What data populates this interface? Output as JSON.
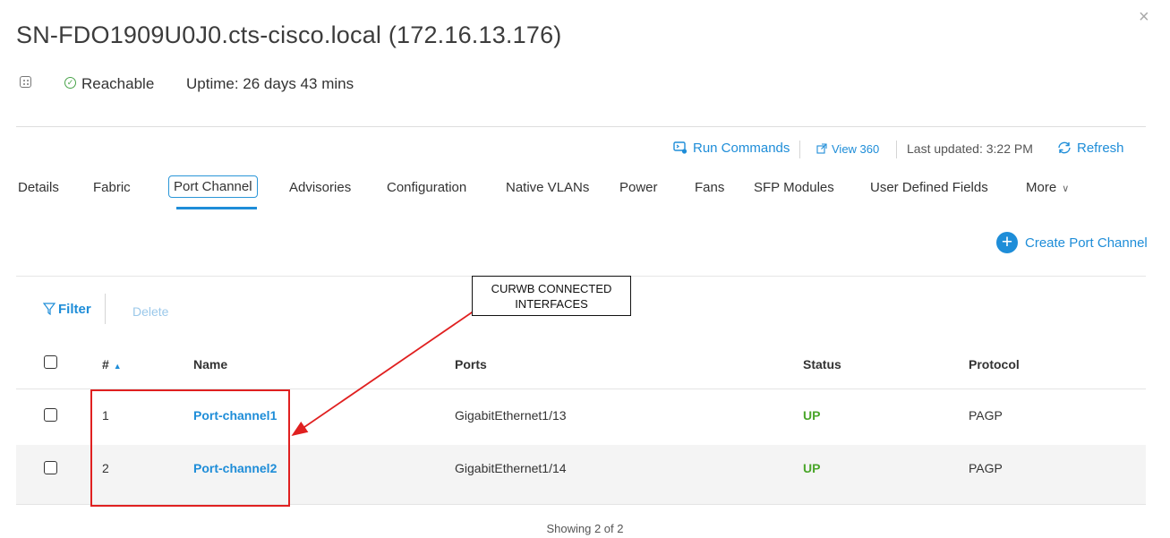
{
  "header": {
    "title": "SN-FDO1909U0J0.cts-cisco.local (172.16.13.176)",
    "reachability": "Reachable",
    "uptime": "Uptime: 26 days 43 mins",
    "close_glyph": "×"
  },
  "actions": {
    "run_commands": "Run Commands",
    "view_360": "View 360",
    "last_updated": "Last updated: 3:22 PM",
    "refresh": "Refresh"
  },
  "tabs": [
    {
      "label": "Details"
    },
    {
      "label": "Fabric"
    },
    {
      "label": "Port Channel",
      "active": true
    },
    {
      "label": "Advisories"
    },
    {
      "label": "Configuration"
    },
    {
      "label": "Native VLANs"
    },
    {
      "label": "Power"
    },
    {
      "label": "Fans"
    },
    {
      "label": "SFP Modules"
    },
    {
      "label": "User Defined Fields"
    },
    {
      "label": "More"
    }
  ],
  "toolbar": {
    "create_label": "Create Port Channel",
    "filter_label": "Filter",
    "delete_label": "Delete"
  },
  "annotation": {
    "line1": "CURWB CONNECTED",
    "line2": "INTERFACES",
    "color": "#e02020"
  },
  "table": {
    "columns": [
      "#",
      "Name",
      "Ports",
      "Status",
      "Protocol"
    ],
    "rows": [
      {
        "num": "1",
        "name": "Port-channel1",
        "ports": "GigabitEthernet1/13",
        "status": "UP",
        "protocol": "PAGP"
      },
      {
        "num": "2",
        "name": "Port-channel2",
        "ports": "GigabitEthernet1/14",
        "status": "UP",
        "protocol": "PAGP"
      }
    ]
  },
  "footer": {
    "showing": "Showing 2 of 2"
  },
  "colors": {
    "accent": "#1e8dd8",
    "status_up": "#4aa62a",
    "reachable": "#49a34a"
  }
}
